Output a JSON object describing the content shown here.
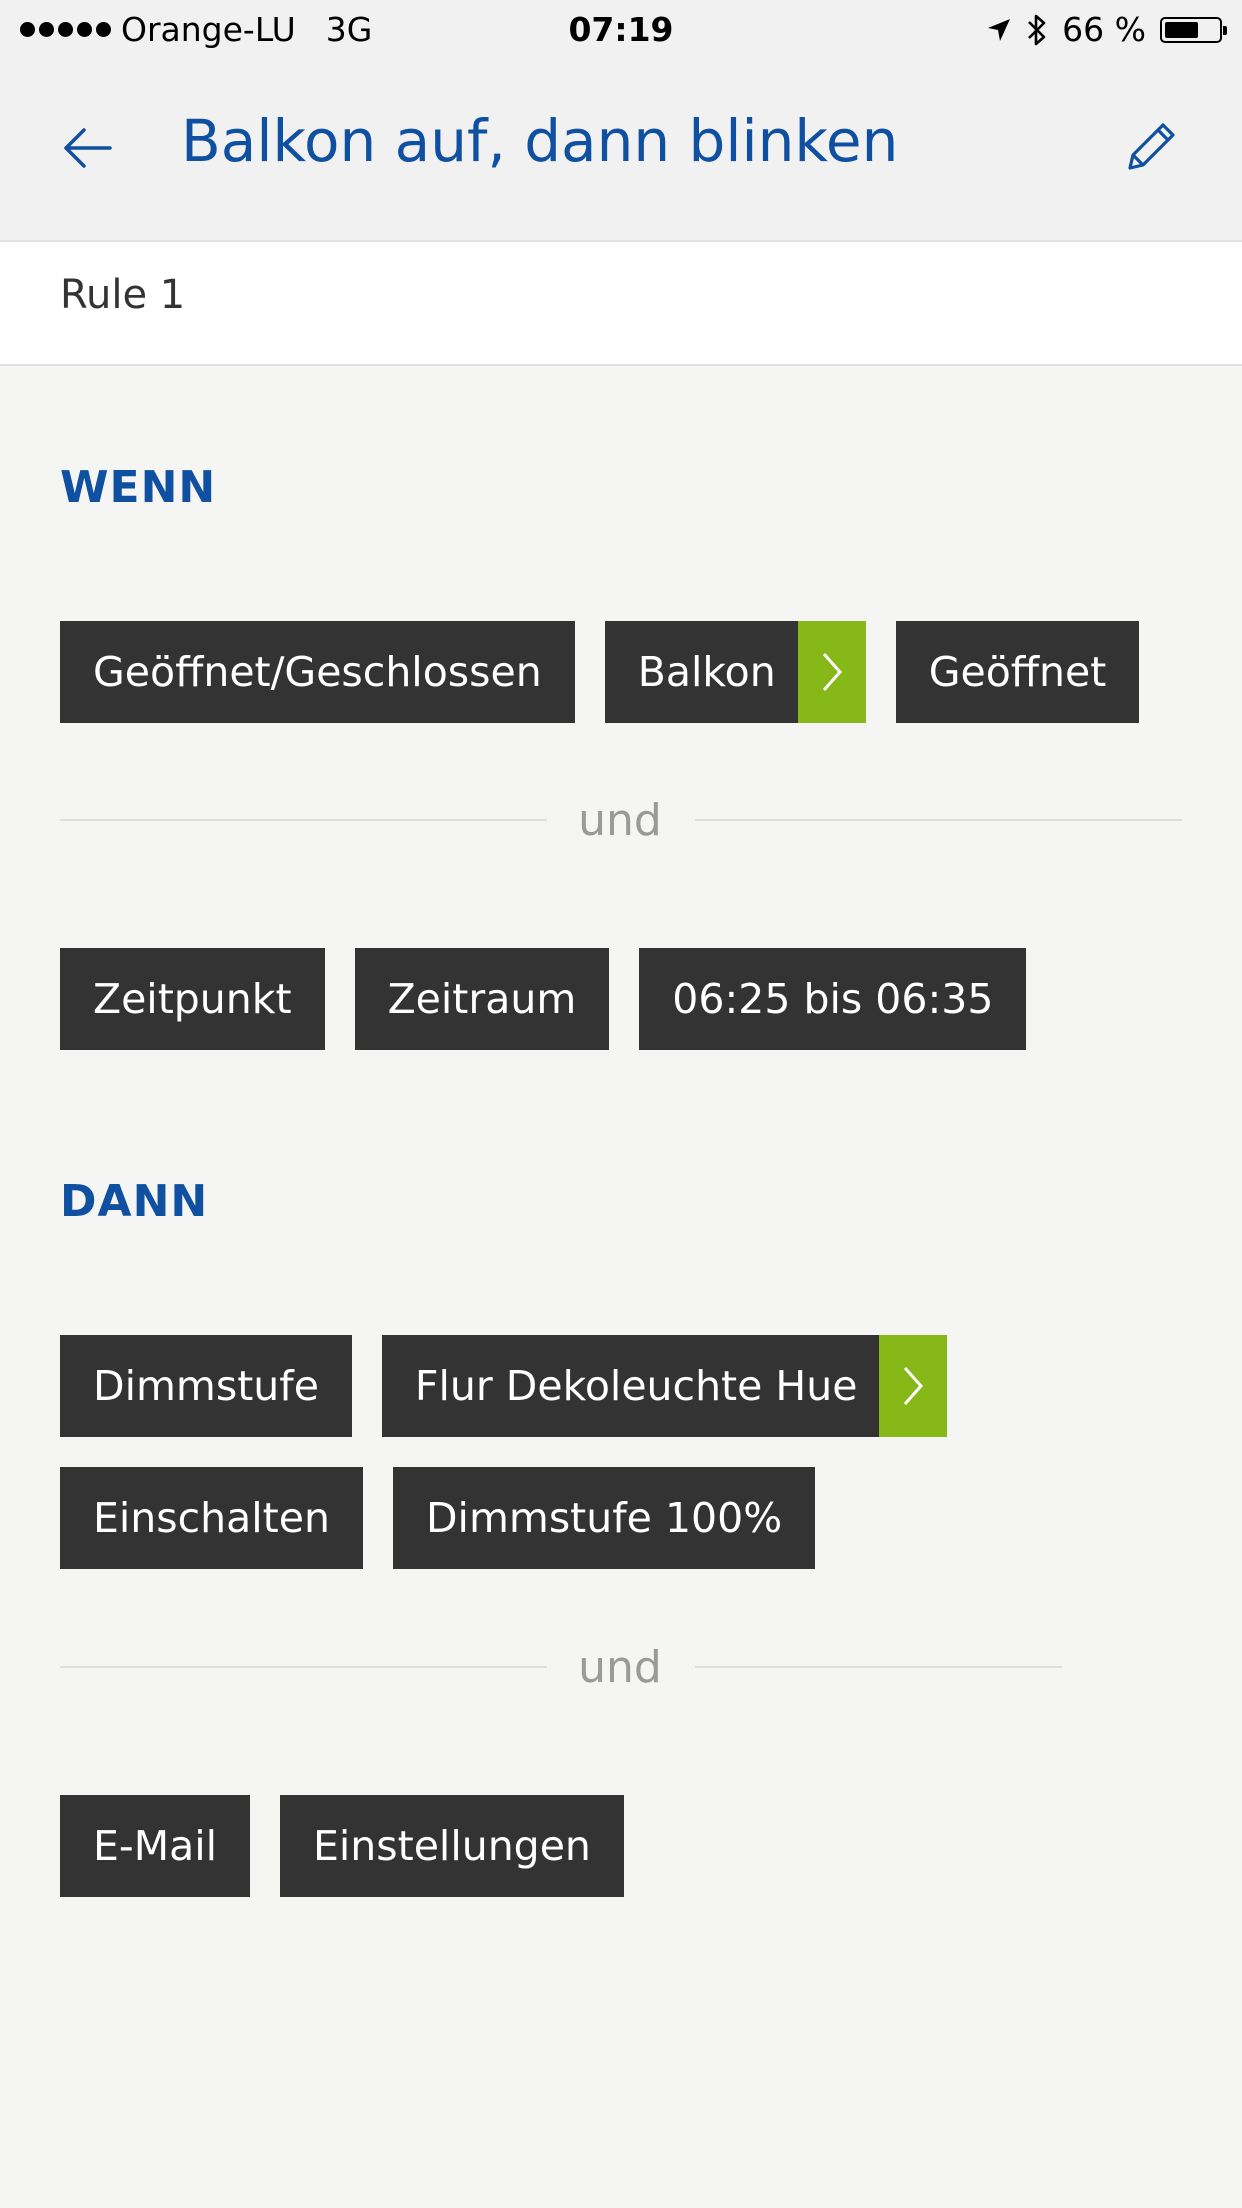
{
  "status_bar": {
    "carrier": "Orange-LU",
    "network": "3G",
    "time": "07:19",
    "battery_text": "66 %",
    "battery_level": 0.66,
    "icons": [
      "signal-icon",
      "location-arrow-icon",
      "bluetooth-icon",
      "battery-icon"
    ]
  },
  "nav": {
    "title": "Balkon auf, dann blinken",
    "back_icon": "arrow-left-icon",
    "edit_icon": "pencil-icon"
  },
  "rule": {
    "name": "Rule 1"
  },
  "wenn": {
    "title": "WENN",
    "row1": {
      "chips": [
        {
          "label": "Geöffnet/Geschlossen"
        },
        {
          "label": "Balkon",
          "has_arrow": true
        },
        {
          "label": "Geöffnet"
        }
      ]
    },
    "connector": "und",
    "row2": {
      "chips": [
        {
          "label": "Zeitpunkt"
        },
        {
          "label": "Zeitraum"
        },
        {
          "label": "06:25 bis 06:35"
        }
      ]
    }
  },
  "dann": {
    "title": "DANN",
    "row1": {
      "chips": [
        {
          "label": "Dimmstufe"
        },
        {
          "label": "Flur Dekoleuchte Hue",
          "has_arrow": true
        }
      ]
    },
    "row2": {
      "chips": [
        {
          "label": "Einschalten"
        },
        {
          "label": "Dimmstufe 100%"
        }
      ]
    },
    "connector": "und",
    "row3": {
      "chips": [
        {
          "label": "E-Mail"
        },
        {
          "label": "Einstellungen"
        }
      ]
    }
  },
  "colors": {
    "accent_blue": "#1050a0",
    "chip_bg": "#333333",
    "arrow_green": "#86b817",
    "page_bg": "#f5f5f4",
    "connector_gray": "#9a9a9a"
  }
}
